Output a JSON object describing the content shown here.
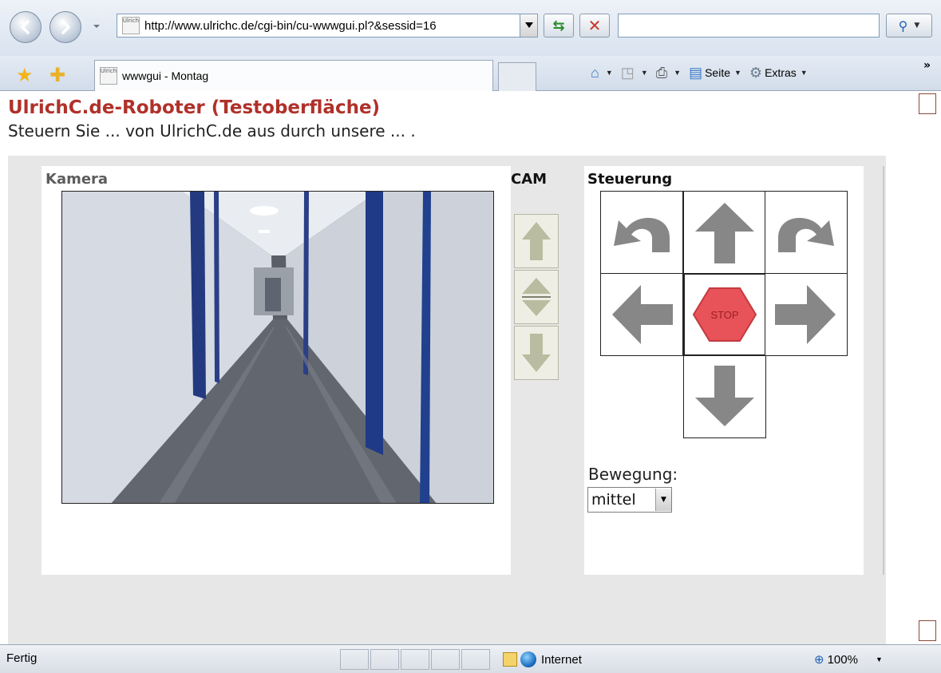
{
  "browser": {
    "back_label": "Back",
    "forward_label": "Forward",
    "url": "http://www.ulrichc.de/cgi-bin/cu-wwwgui.pl?&sessid=16",
    "search_placeholder": "",
    "tab_title": "wwwgui - Montag",
    "favicon_text": "Ulrich",
    "commands": {
      "home": "",
      "feeds": "",
      "print": "",
      "page": "Seite",
      "tools": "Extras"
    }
  },
  "page": {
    "title": "UlrichC.de-Roboter (Testoberfläche)",
    "subtitle": "Steuern Sie ... von UlrichC.de aus durch unsere ... ."
  },
  "camera": {
    "header": "Kamera"
  },
  "cam_controls": {
    "header": "CAM",
    "buttons": [
      "cam-up",
      "cam-center",
      "cam-down"
    ]
  },
  "steering": {
    "header": "Steuerung",
    "stop_label": "STOP",
    "movement_label": "Bewegung:",
    "movement_value": "mittel",
    "colors": {
      "arrow": "#878787",
      "stop": "#e8535a"
    }
  },
  "status": {
    "text": "Fertig",
    "zone": "Internet",
    "zoom": "100%"
  }
}
